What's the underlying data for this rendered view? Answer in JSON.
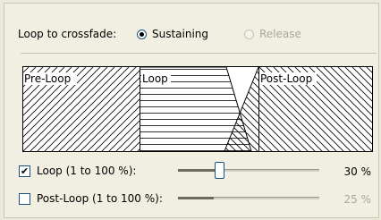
{
  "crossfade": {
    "label": "Loop to crossfade:",
    "options": [
      {
        "label": "Sustaining",
        "selected": true,
        "enabled": true
      },
      {
        "label": "Release",
        "selected": false,
        "enabled": false
      }
    ]
  },
  "diagram": {
    "pre_loop_label": "Pre-Loop",
    "loop_label": "Loop",
    "post_loop_label": "Post-Loop"
  },
  "loop_control": {
    "label": "Loop (1 to 100 %):",
    "checked": true,
    "value_text": "30 %",
    "slider_fraction": 0.3
  },
  "post_loop_control": {
    "label": "Post-Loop (1 to 100 %):",
    "checked": false,
    "value_text": "25 %",
    "slider_fraction": 0.25
  }
}
